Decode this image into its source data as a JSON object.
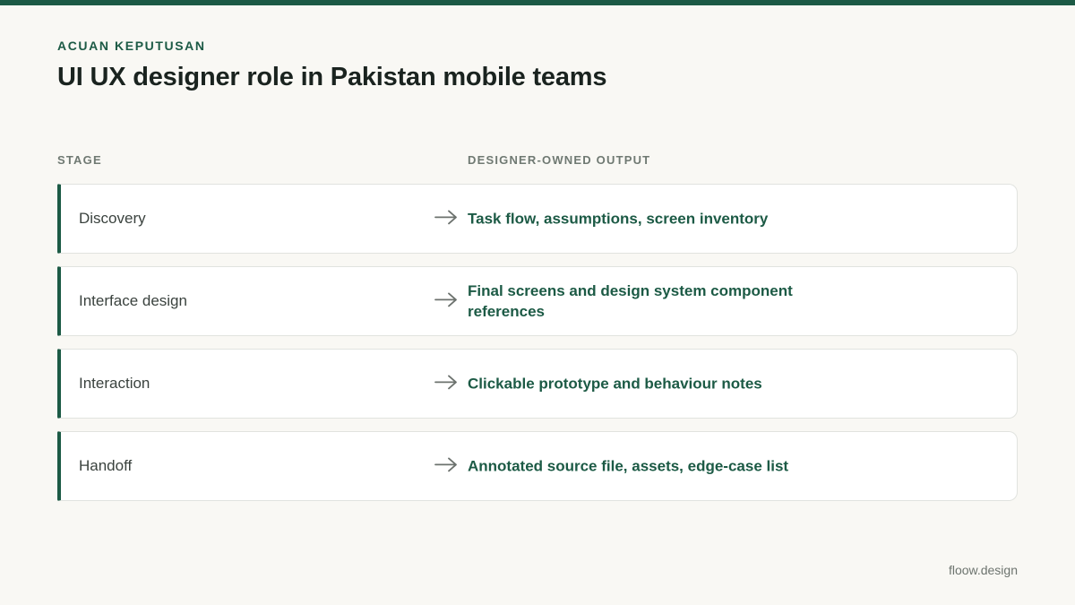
{
  "header": {
    "eyebrow": "ACUAN KEPUTUSAN",
    "title": "UI UX designer role in Pakistan mobile teams"
  },
  "table": {
    "columns": {
      "stage": "STAGE",
      "output": "DESIGNER-OWNED OUTPUT"
    },
    "rows": [
      {
        "stage": "Discovery",
        "output": "Task flow, assumptions, screen inventory"
      },
      {
        "stage": "Interface design",
        "output": "Final screens and design system component references"
      },
      {
        "stage": "Interaction",
        "output": "Clickable prototype and behaviour notes"
      },
      {
        "stage": "Handoff",
        "output": "Annotated source file, assets, edge-case list"
      }
    ]
  },
  "footer": {
    "brand": "floow.design"
  },
  "colors": {
    "accent": "#1c5a45",
    "background": "#f9f8f4",
    "muted": "#6f7972"
  },
  "icons": {
    "row_arrow": "arrow-right-icon"
  }
}
